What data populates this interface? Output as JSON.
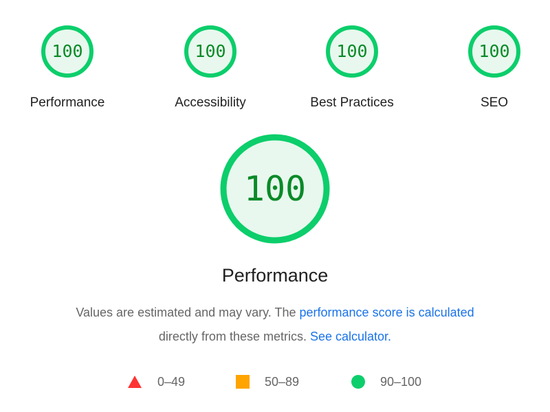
{
  "categories": [
    {
      "label": "Performance",
      "score": "100"
    },
    {
      "label": "Accessibility",
      "score": "100"
    },
    {
      "label": "Best Practices",
      "score": "100"
    },
    {
      "label": "SEO",
      "score": "100"
    }
  ],
  "main": {
    "score": "100",
    "title": "Performance",
    "description_part1": "Values are estimated and may vary. The ",
    "link_score": "performance score is calculated",
    "description_part2": "directly from these metrics. ",
    "link_calculator": "See calculator."
  },
  "legend": [
    {
      "icon": "triangle-icon",
      "range": "0–49",
      "color": "#ff3333"
    },
    {
      "icon": "square-icon",
      "range": "50–89",
      "color": "#ffa400"
    },
    {
      "icon": "circle-icon",
      "range": "90–100",
      "color": "#0cce6b"
    }
  ],
  "colors": {
    "pass": "#0cce6b",
    "pass_fill": "#e8f8ee",
    "pass_text": "#0a8a28",
    "link": "#1a73e8"
  }
}
